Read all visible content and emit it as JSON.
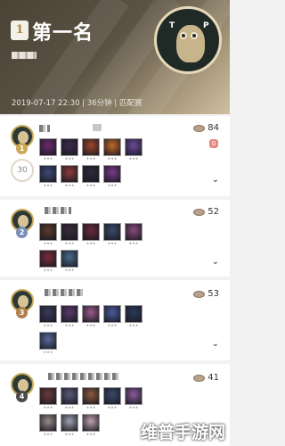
{
  "header": {
    "rank_number": "1",
    "rank_title": "第一名",
    "match_meta": "2019-07-17 22:30 | 36分钟 | 匹配赛",
    "avatar_letters": [
      "T",
      "P"
    ]
  },
  "players": [
    {
      "rank": "1",
      "level": "30",
      "coins": "84",
      "rank_color": "#c9a955",
      "champions": [
        [
          "#6b2a6e",
          "#3a2a4a",
          "#a0462a",
          "#c06a2a",
          "#6a4a9a"
        ],
        [
          "#3c4a7a",
          "#8a3a3a",
          "#2a2a3a",
          "#7a3a8a"
        ]
      ]
    },
    {
      "rank": "2",
      "level": "",
      "coins": "52",
      "rank_color": "#7a8fb8",
      "champions": [
        [
          "#5a3a2a",
          "#3a2a3a",
          "#6a2a3a",
          "#3a4a6a",
          "#8a4a7a"
        ],
        [
          "#7a2a3a",
          "#4a6a8a"
        ]
      ]
    },
    {
      "rank": "3",
      "level": "",
      "coins": "53",
      "rank_color": "#b0804a",
      "champions": [
        [
          "#3a3a5a",
          "#5a3a6a",
          "#9a5a8a",
          "#4a5a9a",
          "#2a3a5a"
        ],
        [
          "#5a6a9a"
        ]
      ]
    },
    {
      "rank": "4",
      "level": "",
      "coins": "41",
      "rank_color": "#4a4a4a",
      "champions": [
        [
          "#6a3a3a",
          "#5a5a7a",
          "#8a5a3a",
          "#3a4a6a",
          "#8a5a9a"
        ],
        [
          "#9a8a8a",
          "#a0a0b0",
          "#c0a0b0"
        ]
      ]
    }
  ],
  "watermark": "维普手游网"
}
